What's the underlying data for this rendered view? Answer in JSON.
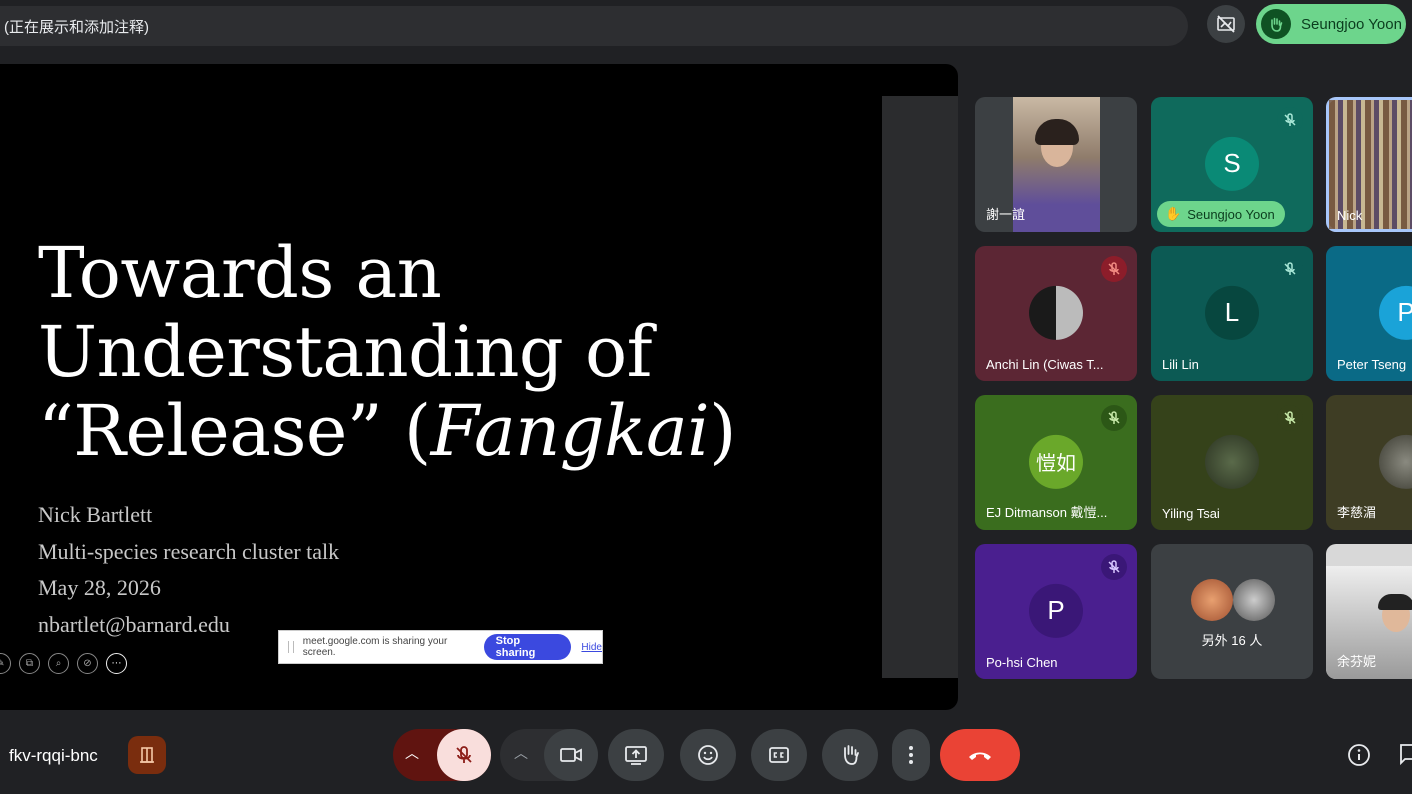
{
  "top_bar": {
    "status_text": "(正在展示和添加注释)"
  },
  "raised_hand": {
    "name": "Seungjoo Yoon"
  },
  "slide": {
    "title_line1": "Towards an",
    "title_line2": "Understanding of",
    "title_line3_prefix": "“Release” (",
    "title_line3_italic": "Fangkai",
    "title_line3_suffix": ")",
    "author": "Nick Bartlett",
    "event": "Multi-species research cluster talk",
    "date": "May 28, 2026",
    "email": "nbartlet@barnard.edu"
  },
  "share_notice": {
    "text": "meet.google.com is sharing your screen.",
    "stop_label": "Stop sharing",
    "hide_label": "Hide"
  },
  "participants": [
    {
      "name": "謝一誼",
      "avatar": "",
      "color": "#3c4043"
    },
    {
      "name": "Seungjoo Yoon",
      "avatar": "S",
      "color": "#0f6a5c"
    },
    {
      "name": "Nick",
      "avatar": "",
      "color": "#6b5a4a"
    },
    {
      "name": "Anchi Lin (Ciwas T...",
      "avatar": "",
      "color": "#5c2634"
    },
    {
      "name": "Lili Lin",
      "avatar": "L",
      "color": "#0c5a54"
    },
    {
      "name": "Peter Tseng",
      "avatar": "P",
      "color": "#0a6a86"
    },
    {
      "name": "EJ Ditmanson 戴愷...",
      "avatar": "愷如",
      "color": "#3a6d1e"
    },
    {
      "name": "Yiling Tsai",
      "avatar": "",
      "color": "#35421a"
    },
    {
      "name": "李慈湄",
      "avatar": "",
      "color": "#3e3d24"
    },
    {
      "name": "Po-hsi Chen",
      "avatar": "P",
      "color": "#4a1f8f"
    },
    {
      "name": "另外 16 人",
      "avatar": "",
      "color": "#3c4043"
    },
    {
      "name": "余芬妮",
      "avatar": "",
      "color": "#d8d8d8"
    }
  ],
  "meeting": {
    "code": "fkv-rqqi-bnc"
  },
  "colors": {
    "background": "#202124",
    "raised_hand": "#6dd58c",
    "mic_off_red": "#f28b82",
    "end_call": "#ea4335",
    "share_blue": "#3b49df"
  }
}
